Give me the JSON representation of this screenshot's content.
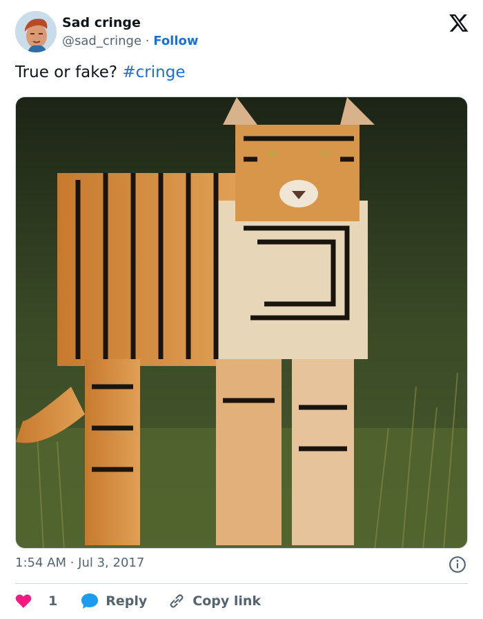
{
  "author": {
    "name": "Sad cringe",
    "handle": "@sad_cringe",
    "separator": "·",
    "follow_label": "Follow"
  },
  "tweet": {
    "text": "True or fake?",
    "hashtag": "#cringe",
    "timestamp": "1:54 AM · Jul 3, 2017"
  },
  "actions": {
    "like_count": "1",
    "reply_label": "Reply",
    "copy_link_label": "Copy link"
  },
  "colors": {
    "link": "#1d6fd8",
    "heart": "#f91880",
    "reply_bubble": "#1d9bf0",
    "muted": "#536471"
  },
  "icons": [
    "x-logo-icon",
    "info-icon",
    "heart-icon",
    "reply-bubble-icon",
    "link-icon"
  ]
}
